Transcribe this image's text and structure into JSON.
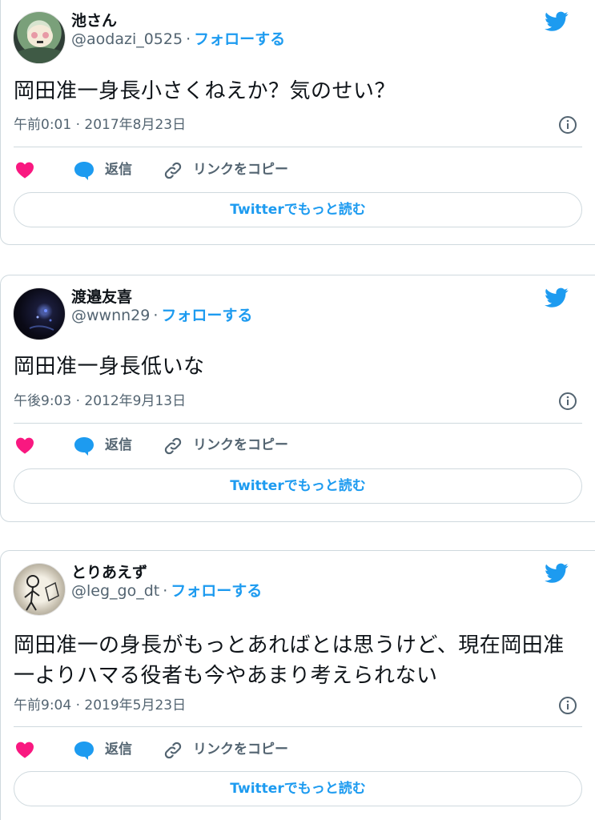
{
  "tweets": [
    {
      "name": "池さん",
      "handle": "@aodazi_0525",
      "follow": "フォローする",
      "text": "岡田准一身長小さくねえか？気のせい？",
      "timestamp": "午前0:01 · 2017年8月23日"
    },
    {
      "name": "渡邉友喜",
      "handle": "@wwnn29",
      "follow": "フォローする",
      "text": "岡田准一身長低いな",
      "timestamp": "午後9:03 · 2012年9月13日"
    },
    {
      "name": "とりあえず",
      "handle": "@leg_go_dt",
      "follow": "フォローする",
      "text": "岡田准一の身長がもっとあればとは思うけど、現在岡田准一よりハマる役者も今やあまり考えられない",
      "timestamp": "午前9:04 · 2019年5月23日"
    }
  ],
  "actions": {
    "reply": "返信",
    "copy_link": "リンクをコピー",
    "read_more": "Twitterでもっと読む",
    "separator": "·"
  },
  "colors": {
    "accent": "#1d9bf0",
    "heart": "#f91880",
    "muted": "#536471",
    "border": "#cfd9de"
  },
  "icons": [
    "twitter-bird-icon",
    "info-icon",
    "heart-icon",
    "reply-bubble-icon",
    "link-icon"
  ]
}
